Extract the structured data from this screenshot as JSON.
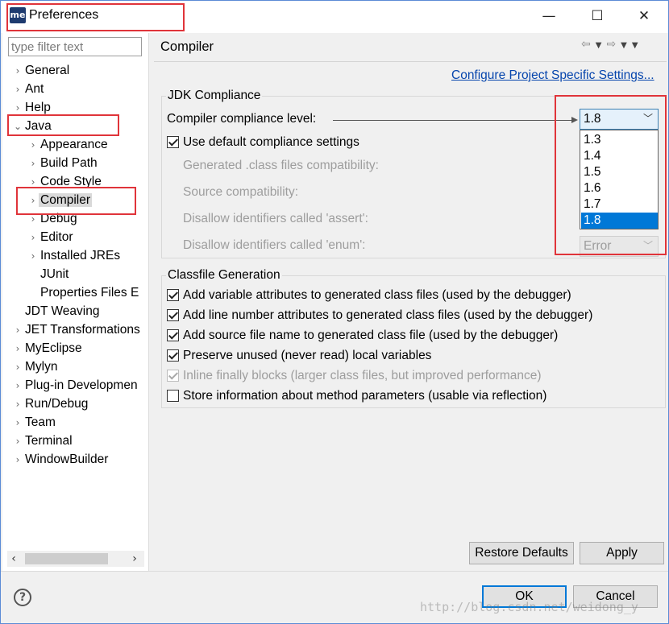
{
  "window": {
    "title": "Preferences",
    "app_icon_text": "me",
    "controls": {
      "minimize": "—",
      "maximize": "☐",
      "close": "✕"
    }
  },
  "left_panel": {
    "filter_placeholder": "type filter text",
    "tree": [
      {
        "label": "General",
        "expanded": false
      },
      {
        "label": "Ant",
        "expanded": false
      },
      {
        "label": "Help",
        "expanded": false
      },
      {
        "label": "Java",
        "expanded": true
      },
      {
        "label": "Appearance",
        "expanded": false
      },
      {
        "label": "Build Path",
        "expanded": false
      },
      {
        "label": "Code Style",
        "expanded": false
      },
      {
        "label": "Compiler",
        "expanded": false,
        "selected": true
      },
      {
        "label": "Debug",
        "expanded": false
      },
      {
        "label": "Editor",
        "expanded": false
      },
      {
        "label": "Installed JREs",
        "expanded": false
      },
      {
        "label": "JUnit"
      },
      {
        "label": "Properties Files E"
      },
      {
        "label": "JDT Weaving"
      },
      {
        "label": "JET Transformations",
        "expanded": false
      },
      {
        "label": "MyEclipse",
        "expanded": false
      },
      {
        "label": "Mylyn",
        "expanded": false
      },
      {
        "label": "Plug-in Developmen",
        "expanded": false
      },
      {
        "label": "Run/Debug",
        "expanded": false
      },
      {
        "label": "Team",
        "expanded": false
      },
      {
        "label": "Terminal",
        "expanded": false
      },
      {
        "label": "WindowBuilder",
        "expanded": false
      }
    ]
  },
  "page": {
    "title": "Compiler",
    "configure_link": "Configure Project Specific Settings...",
    "jdk_group": {
      "title": "JDK Compliance",
      "compliance_label": "Compiler compliance level:",
      "compliance_value": "1.8",
      "compliance_options": [
        "1.3",
        "1.4",
        "1.5",
        "1.6",
        "1.7",
        "1.8"
      ],
      "use_default_label": "Use default compliance settings",
      "use_default_checked": true,
      "generated_label": "Generated .class files compatibility:",
      "source_label": "Source compatibility:",
      "assert_label": "Disallow identifiers called 'assert':",
      "enum_label": "Disallow identifiers called 'enum':",
      "enum_value": "Error"
    },
    "classfile_group": {
      "title": "Classfile Generation",
      "options": [
        {
          "label": "Add variable attributes to generated class files (used by the debugger)",
          "checked": true,
          "enabled": true
        },
        {
          "label": "Add line number attributes to generated class files (used by the debugger)",
          "checked": true,
          "enabled": true
        },
        {
          "label": "Add source file name to generated class file (used by the debugger)",
          "checked": true,
          "enabled": true
        },
        {
          "label": "Preserve unused (never read) local variables",
          "checked": true,
          "enabled": true
        },
        {
          "label": "Inline finally blocks (larger class files, but improved performance)",
          "checked": true,
          "enabled": false
        },
        {
          "label": "Store information about method parameters (usable via reflection)",
          "checked": false,
          "enabled": true
        }
      ]
    },
    "restore_defaults_label": "Restore Defaults",
    "apply_label": "Apply"
  },
  "footer": {
    "ok_label": "OK",
    "cancel_label": "Cancel",
    "help_icon_text": "?",
    "watermark": "http://blog.csdn.net/weidong_y"
  }
}
